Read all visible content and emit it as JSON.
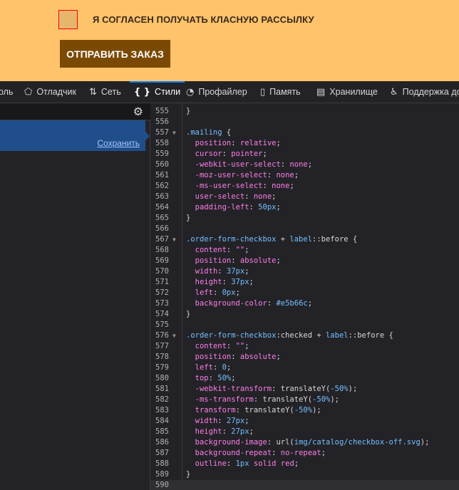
{
  "page": {
    "checkbox_label": "Я СОГЛАСЕН ПОЛУЧАТЬ КЛАСНУЮ РАССЫЛКУ",
    "submit_label": "ОТПРАВИТЬ ЗАКАЗ"
  },
  "toolbar": {
    "tabs": [
      {
        "label": "оль",
        "icon": ""
      },
      {
        "label": "Отладчик",
        "icon": "⬠"
      },
      {
        "label": "Сеть",
        "icon": "⇅"
      },
      {
        "label": "Стили",
        "icon": "{ }"
      },
      {
        "label": "Профайлер",
        "icon": "◔"
      },
      {
        "label": "Память",
        "icon": "▯"
      },
      {
        "label": "Хранилище",
        "icon": "▤"
      },
      {
        "label": "Поддержка до",
        "icon": "♿"
      }
    ]
  },
  "left_pane": {
    "save_label": "Сохранить"
  },
  "editor": {
    "lines": [
      {
        "n": "555",
        "text": "}"
      },
      {
        "n": "556",
        "text": ""
      },
      {
        "n": "557",
        "text": ".mailing {",
        "fold": true
      },
      {
        "n": "558",
        "text": "  position: relative;"
      },
      {
        "n": "559",
        "text": "  cursor: pointer;"
      },
      {
        "n": "560",
        "text": "  -webkit-user-select: none;"
      },
      {
        "n": "561",
        "text": "  -moz-user-select: none;"
      },
      {
        "n": "562",
        "text": "  -ms-user-select: none;"
      },
      {
        "n": "563",
        "text": "  user-select: none;"
      },
      {
        "n": "564",
        "text": "  padding-left: 50px;"
      },
      {
        "n": "565",
        "text": "}"
      },
      {
        "n": "566",
        "text": ""
      },
      {
        "n": "567",
        "text": ".order-form-checkbox + label::before {",
        "fold": true
      },
      {
        "n": "568",
        "text": "  content: \"\";"
      },
      {
        "n": "569",
        "text": "  position: absolute;"
      },
      {
        "n": "570",
        "text": "  width: 37px;"
      },
      {
        "n": "571",
        "text": "  height: 37px;"
      },
      {
        "n": "572",
        "text": "  left: 0px;"
      },
      {
        "n": "573",
        "text": "  background-color: #e5b66c;"
      },
      {
        "n": "574",
        "text": "}"
      },
      {
        "n": "575",
        "text": ""
      },
      {
        "n": "576",
        "text": ".order-form-checkbox:checked + label::before {",
        "fold": true
      },
      {
        "n": "577",
        "text": "  content: \"\";"
      },
      {
        "n": "578",
        "text": "  position: absolute;"
      },
      {
        "n": "579",
        "text": "  left: 0;"
      },
      {
        "n": "580",
        "text": "  top: 50%;"
      },
      {
        "n": "581",
        "text": "  -webkit-transform: translateY(-50%);"
      },
      {
        "n": "582",
        "text": "  -ms-transform: translateY(-50%);"
      },
      {
        "n": "583",
        "text": "  transform: translateY(-50%);"
      },
      {
        "n": "584",
        "text": "  width: 27px;"
      },
      {
        "n": "585",
        "text": "  height: 27px;"
      },
      {
        "n": "586",
        "text": "  background-image: url(img/catalog/checkbox-off.svg);"
      },
      {
        "n": "587",
        "text": "  background-repeat: no-repeat;"
      },
      {
        "n": "588",
        "text": "  outline: 1px solid red;"
      },
      {
        "n": "589",
        "text": "}"
      },
      {
        "n": "590",
        "text": "",
        "current": true
      }
    ]
  }
}
